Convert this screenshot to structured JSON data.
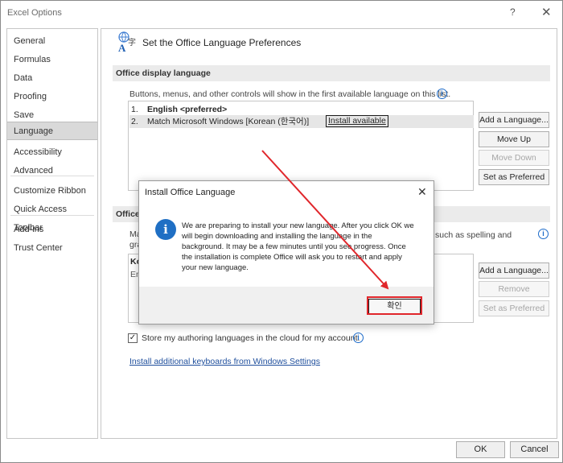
{
  "window": {
    "title": "Excel Options",
    "help": "?",
    "close": "✕"
  },
  "nav": {
    "items": [
      {
        "label": "General"
      },
      {
        "label": "Formulas"
      },
      {
        "label": "Data"
      },
      {
        "label": "Proofing"
      },
      {
        "label": "Save"
      },
      {
        "label": "Language"
      },
      {
        "label": "Accessibility"
      },
      {
        "label": "Advanced"
      },
      {
        "label": "Customize Ribbon"
      },
      {
        "label": "Quick Access Toolbar"
      },
      {
        "label": "Add-ins"
      },
      {
        "label": "Trust Center"
      }
    ],
    "active": "Language"
  },
  "main": {
    "title": "Set the Office Language Preferences",
    "display_section": {
      "header": "Office display language",
      "description": "Buttons, menus, and other controls will show in the first available language on this list.",
      "languages": [
        {
          "num": "1.",
          "name": "English <preferred>"
        },
        {
          "num": "2.",
          "name": "Match Microsoft Windows [Korean (한국어)]",
          "link": "Install available"
        }
      ],
      "buttons": {
        "add": "Add a Language...",
        "move_up": "Move Up",
        "move_down": "Move Down",
        "set_preferred": "Set as Preferred"
      }
    },
    "authoring_section": {
      "header": "Office",
      "desc_start": "Ma",
      "desc_end": "such as spelling and",
      "desc_line2": "gra",
      "list_item1": "Ko",
      "list_item2": "Eng",
      "buttons": {
        "add": "Add a Language...",
        "remove": "Remove",
        "set_preferred": "Set as Preferred"
      }
    },
    "checkbox": {
      "label": "Store my authoring languages in the cloud for my account.",
      "checked": "✓"
    },
    "link": "Install additional keyboards from Windows Settings"
  },
  "footer": {
    "ok": "OK",
    "cancel": "Cancel"
  },
  "dialog": {
    "title": "Install Office Language",
    "close": "✕",
    "icon": "i",
    "message": "We are preparing to install your new language. After you click OK we will begin downloading and installing the language in the background. It may be a few minutes until you see progress. Once the installation is complete Office will ask you to restart and apply your new language.",
    "ok_label": "확인"
  },
  "colors": {
    "annotation": "#e0262b",
    "accent": "#1f6fc4"
  }
}
